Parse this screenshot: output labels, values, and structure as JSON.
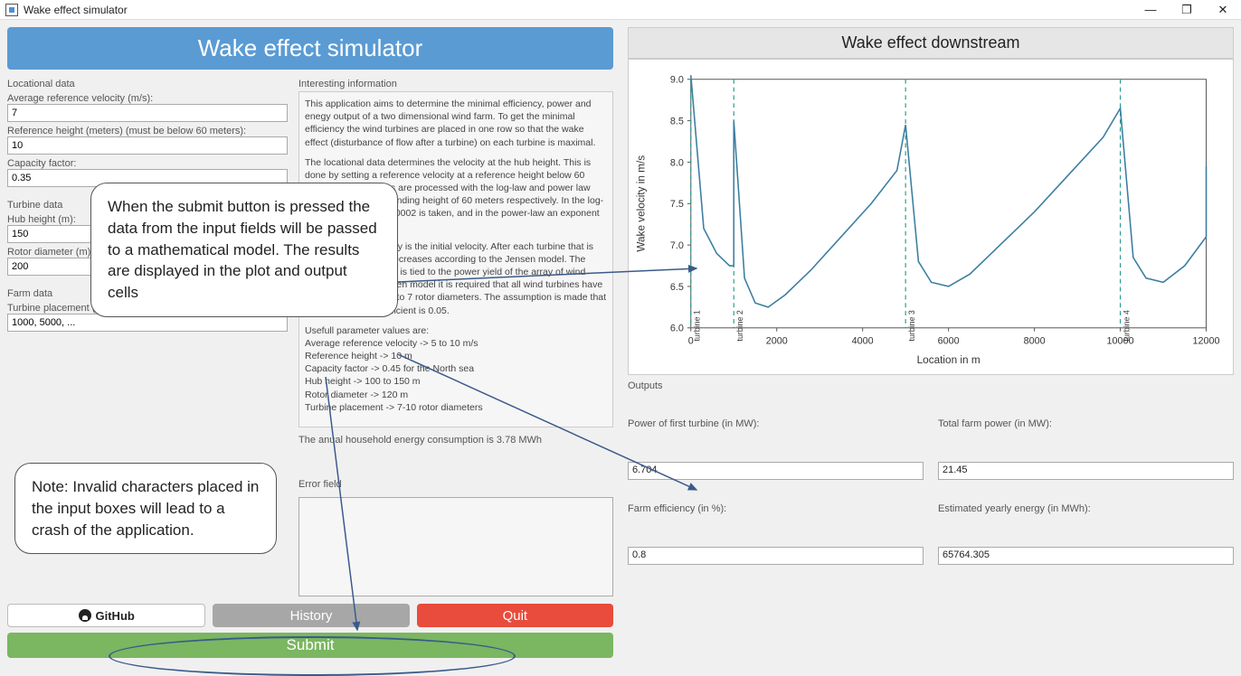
{
  "titlebar": {
    "title": "Wake effect simulator"
  },
  "banner": "Wake effect simulator",
  "locational": {
    "group": "Locational data",
    "velocity_label": "Average reference velocity (m/s):",
    "velocity": "7",
    "ref_height_label": "Reference height (meters) (must be below 60 meters):",
    "ref_height": "10",
    "capacity_label": "Capacity factor:",
    "capacity": "0.35"
  },
  "turbine": {
    "group": "Turbine data",
    "hub_label": "Hub height (m):",
    "hub": "150",
    "rotor_label": "Rotor diameter (m):",
    "rotor": "200"
  },
  "farm": {
    "group": "Farm data",
    "placement_label": "Turbine placement (m, comma-separated, default, and sorted):",
    "placement": "1000, 5000, ..."
  },
  "info": {
    "heading": "Interesting information",
    "p1": "This application aims to determine the minimal efficiency, power and enegy output of a two dimensional wind farm. To get the minimal efficiency the wind turbines are placed in one row so that the wake effect (disturbance of flow after a turbine) on each turbine is maximal.",
    "p2": "The locational data determines the velocity at the hub height. This is done by setting a reference velocity at a reference height below 60 meters. These values are processed with the log-law and power law which both have a blending height of 60 meters respectively. In the log-law a roughness of 0.0002 is taken, and in the power-law an exponent of 0.1 is used.",
    "p3": "The hub height velocity is the initial velocity. After each turbine that is passed the velocity decreases according to the Jensen model. The effect of this decrease is tied to the power yield of the array of wind turbines. For the Jensen model it is required that all wind turbines have minimal distance of 5 to 7 rotor diameters. The assumption is made that the wake decay coefficient is 0.05.",
    "p4_title": "Usefull parameter values are:",
    "p4_items": [
      "Average reference velocity -> 5 to 10 m/s",
      "Reference height -> 10 m",
      "Capacity factor -> 0.45 for the North sea",
      "Hub height -> 100 to 150 m",
      "Rotor diameter -> 120 m",
      "Turbine placement -> 7-10 rotor diameters"
    ],
    "footer": "The anual household energy consumption is 3.78 MWh"
  },
  "error_label": "Error field",
  "buttons": {
    "github": "GitHub",
    "history": "History",
    "quit": "Quit",
    "submit": "Submit"
  },
  "chart_title": "Wake effect downstream",
  "chart_data": {
    "type": "line",
    "title": "Wake effect downstream",
    "xlabel": "Location in m",
    "ylabel": "Wake velocity in m/s",
    "xlim": [
      0,
      12000
    ],
    "ylim": [
      6.0,
      9.0
    ],
    "xticks": [
      0,
      2000,
      4000,
      6000,
      8000,
      10000,
      12000
    ],
    "yticks": [
      6.0,
      6.5,
      7.0,
      7.5,
      8.0,
      8.5,
      9.0
    ],
    "turbine_markers": [
      {
        "name": "turbine 1",
        "x": 0
      },
      {
        "name": "turbine 2",
        "x": 1000
      },
      {
        "name": "turbine 3",
        "x": 5000
      },
      {
        "name": "turbine 4",
        "x": 10000
      }
    ],
    "series": [
      {
        "name": "wake velocity",
        "points": [
          [
            0,
            9.05
          ],
          [
            300,
            7.2
          ],
          [
            600,
            6.9
          ],
          [
            900,
            6.75
          ],
          [
            1000,
            8.5
          ],
          [
            1250,
            6.6
          ],
          [
            1500,
            6.3
          ],
          [
            1800,
            6.25
          ],
          [
            2200,
            6.4
          ],
          [
            2800,
            6.7
          ],
          [
            3500,
            7.1
          ],
          [
            4200,
            7.5
          ],
          [
            4800,
            7.9
          ],
          [
            5000,
            8.45
          ],
          [
            5300,
            6.8
          ],
          [
            5600,
            6.55
          ],
          [
            6000,
            6.5
          ],
          [
            6500,
            6.65
          ],
          [
            7200,
            7.0
          ],
          [
            8000,
            7.4
          ],
          [
            8800,
            7.85
          ],
          [
            9600,
            8.3
          ],
          [
            10000,
            8.65
          ],
          [
            10300,
            6.85
          ],
          [
            10600,
            6.6
          ],
          [
            11000,
            6.55
          ],
          [
            11500,
            6.75
          ],
          [
            12000,
            7.1
          ],
          [
            12500,
            7.5
          ],
          [
            13000,
            7.95
          ]
        ]
      }
    ]
  },
  "outputs": {
    "group": "Outputs",
    "power_first_label": "Power of first turbine (in MW):",
    "power_first": "6.704",
    "total_power_label": "Total farm power (in MW):",
    "total_power": "21.45",
    "efficiency_label": "Farm efficiency (in %):",
    "efficiency": "0.8",
    "yearly_energy_label": "Estimated yearly energy (in MWh):",
    "yearly_energy": "65764.305"
  },
  "callouts": {
    "c1": "When the submit button is pressed the data from the input fields will be passed to a mathematical model. The results are displayed in the plot and output cells",
    "c2": "Note: Invalid characters placed in the input boxes will lead to a crash of the application."
  }
}
